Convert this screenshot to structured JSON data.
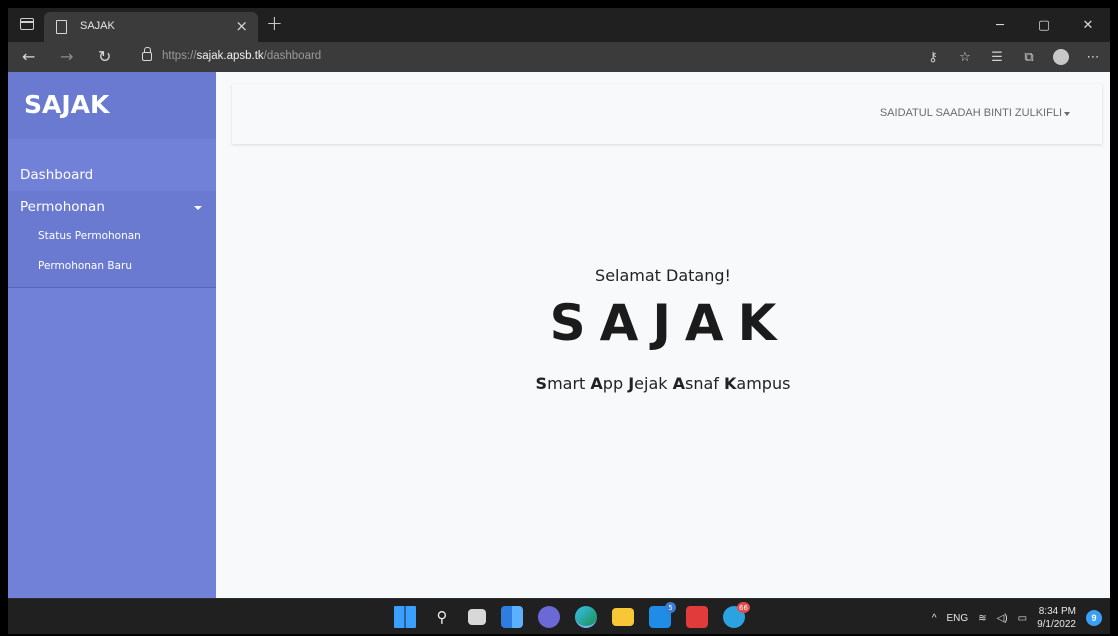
{
  "browser": {
    "tab_title": "SAJAK",
    "tab_close": "×",
    "new_tab": "+",
    "url_prefix": "https://",
    "url_host": "sajak.apsb.tk",
    "url_path": "/dashboard"
  },
  "sidebar": {
    "brand": "SAJAK",
    "items": [
      {
        "label": "Dashboard"
      },
      {
        "label": "Permohonan",
        "children": [
          {
            "label": "Status Permohonan"
          },
          {
            "label": "Permohonan Baru"
          }
        ]
      }
    ]
  },
  "topbar": {
    "user_name": "SAIDATUL SAADAH BINTI ZULKIFLI"
  },
  "main": {
    "welcome": "Selamat Datang!",
    "title": "SAJAK",
    "tagline_parts": [
      {
        "bold": "S",
        "rest": "mart "
      },
      {
        "bold": "A",
        "rest": "pp "
      },
      {
        "bold": "J",
        "rest": "ejak "
      },
      {
        "bold": "A",
        "rest": "snaf "
      },
      {
        "bold": "K",
        "rest": "ampus"
      }
    ]
  },
  "taskbar": {
    "language": "ENG",
    "time": "8:34 PM",
    "date": "9/1/2022",
    "notification_count": "9",
    "mail_badge": "5",
    "app_badge": "66",
    "icons": [
      "windows-start-icon",
      "search-icon",
      "task-view-icon",
      "widgets-icon",
      "chat-icon",
      "edge-icon",
      "file-explorer-icon",
      "mail-icon",
      "wps-office-icon",
      "telegram-icon"
    ]
  },
  "colors": {
    "sidebar": "#7181d7",
    "sidebar_dark": "#6a7ad0",
    "page_bg": "#f8f9fb",
    "chrome_bg": "#202020"
  }
}
